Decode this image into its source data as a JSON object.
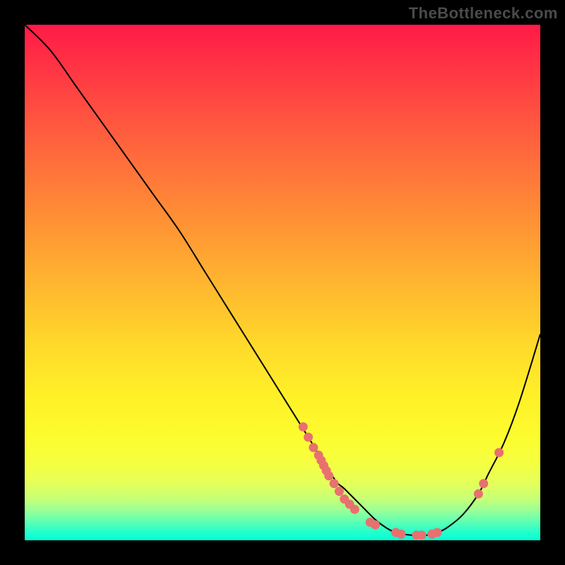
{
  "watermark": "TheBottleneck.com",
  "chart_data": {
    "type": "line",
    "title": "",
    "xlabel": "",
    "ylabel": "",
    "xlim": [
      0,
      100
    ],
    "ylim": [
      0,
      100
    ],
    "grid": false,
    "legend": false,
    "series": [
      {
        "name": "curve",
        "x": [
          0,
          5,
          10,
          15,
          20,
          25,
          30,
          35,
          40,
          45,
          50,
          55,
          60,
          62,
          65,
          68,
          70,
          72,
          75,
          78,
          80,
          82,
          85,
          88,
          90,
          93,
          96,
          100
        ],
        "y": [
          100,
          95,
          88,
          81,
          74,
          67,
          60,
          52,
          44,
          36,
          28,
          20,
          12,
          10,
          7,
          4,
          2.5,
          1.5,
          1,
          1,
          1.5,
          2.5,
          5,
          9,
          13,
          19,
          27,
          40
        ]
      }
    ],
    "markers": [
      {
        "x": 54,
        "y": 22
      },
      {
        "x": 55,
        "y": 20
      },
      {
        "x": 56,
        "y": 18
      },
      {
        "x": 57,
        "y": 16.5
      },
      {
        "x": 57.5,
        "y": 15.5
      },
      {
        "x": 58,
        "y": 14.5
      },
      {
        "x": 58.5,
        "y": 13.5
      },
      {
        "x": 59,
        "y": 12.5
      },
      {
        "x": 60,
        "y": 11
      },
      {
        "x": 61,
        "y": 9.5
      },
      {
        "x": 62,
        "y": 8
      },
      {
        "x": 63,
        "y": 7
      },
      {
        "x": 64,
        "y": 6
      },
      {
        "x": 67,
        "y": 3.5
      },
      {
        "x": 68,
        "y": 3
      },
      {
        "x": 72,
        "y": 1.5
      },
      {
        "x": 73,
        "y": 1.2
      },
      {
        "x": 76,
        "y": 1
      },
      {
        "x": 77,
        "y": 1
      },
      {
        "x": 79,
        "y": 1.2
      },
      {
        "x": 80,
        "y": 1.5
      },
      {
        "x": 88,
        "y": 9
      },
      {
        "x": 89,
        "y": 11
      },
      {
        "x": 92,
        "y": 17
      }
    ],
    "marker_color": "#e87070",
    "curve_color": "#000000"
  }
}
